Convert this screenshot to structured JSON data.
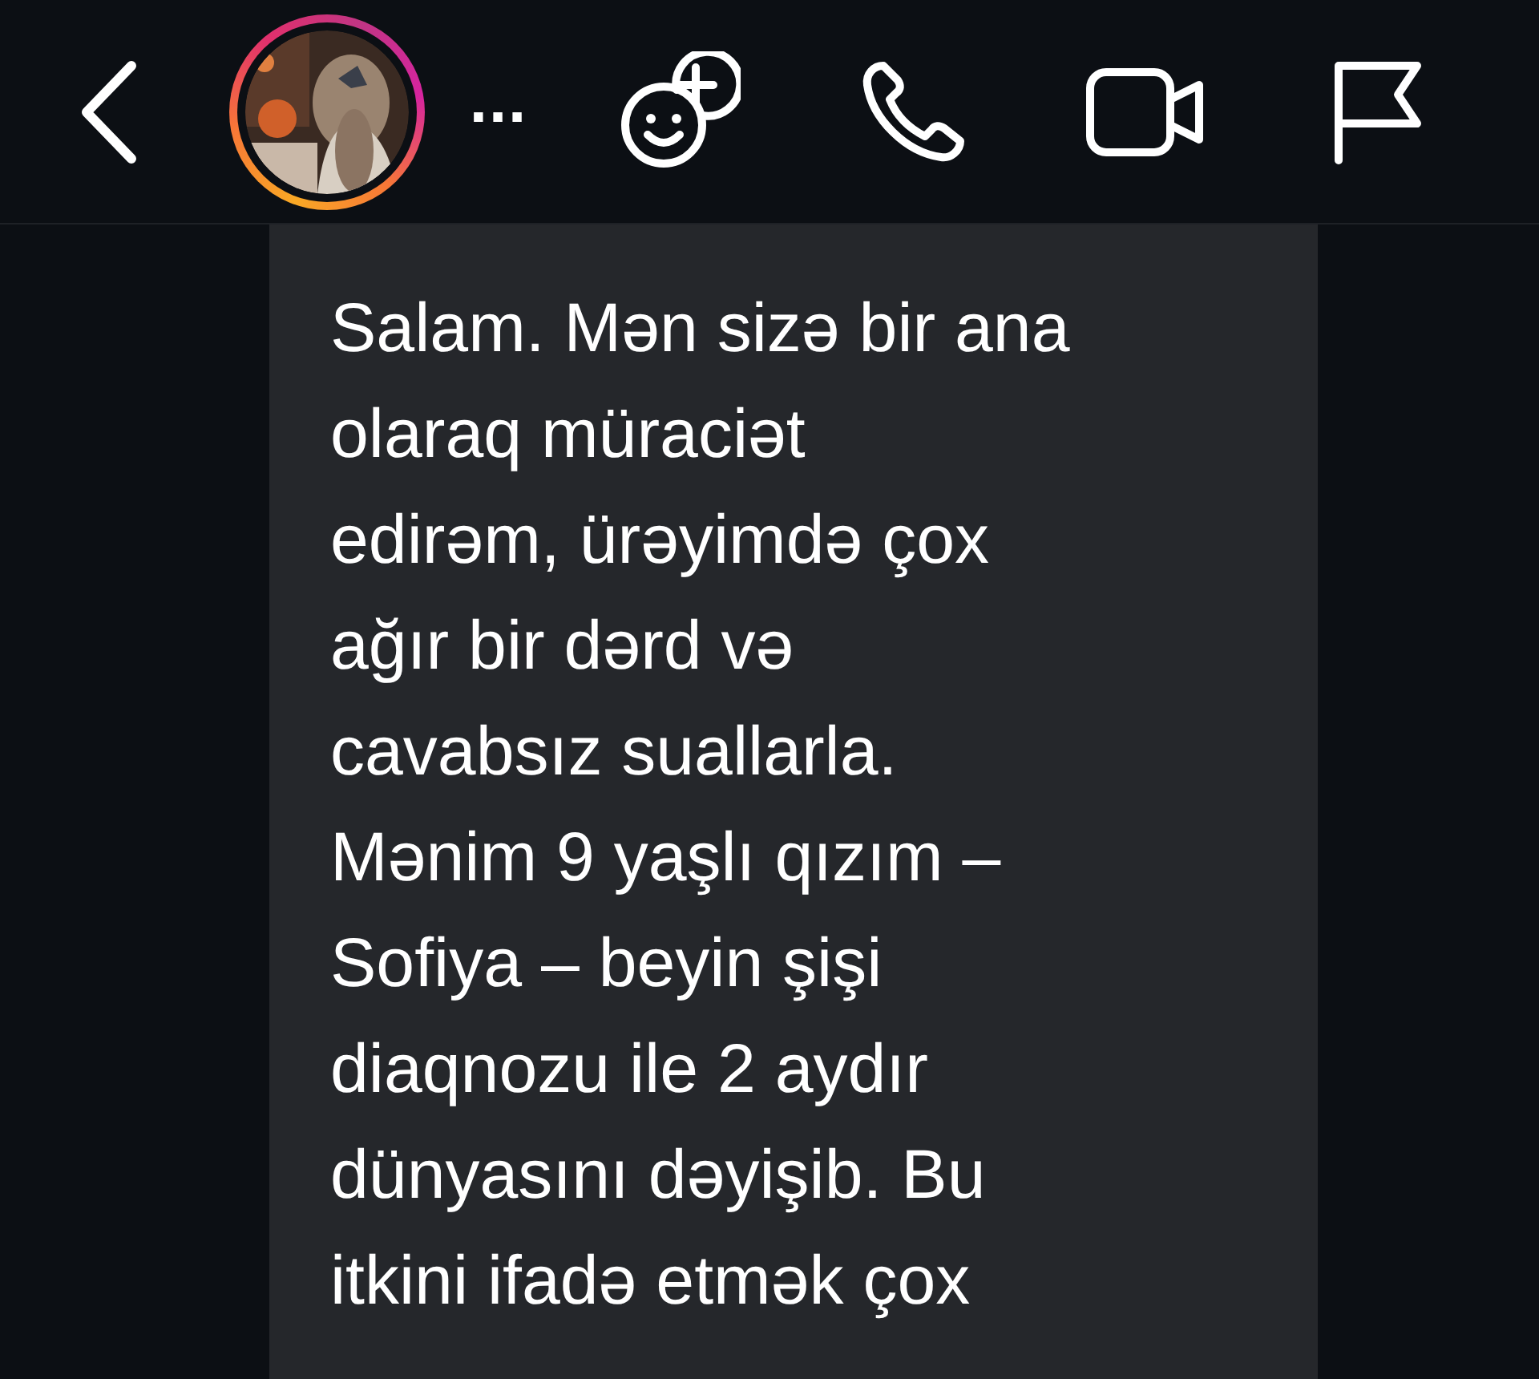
{
  "header": {
    "more": "..."
  },
  "message": {
    "lines": [
      "Salam. Mən sizə bir ana",
      "olaraq müraciət",
      "edirəm, ürəyimdə çox",
      "ağır bir dərd və",
      "cavabsız suallarla.",
      "Mənim 9 yaşlı qızım –",
      "Sofiya – beyin şişi",
      "diaqnozu ile 2 aydır",
      "dünyasını dəyişib. Bu",
      "itkini ifadə etmək çox"
    ]
  }
}
